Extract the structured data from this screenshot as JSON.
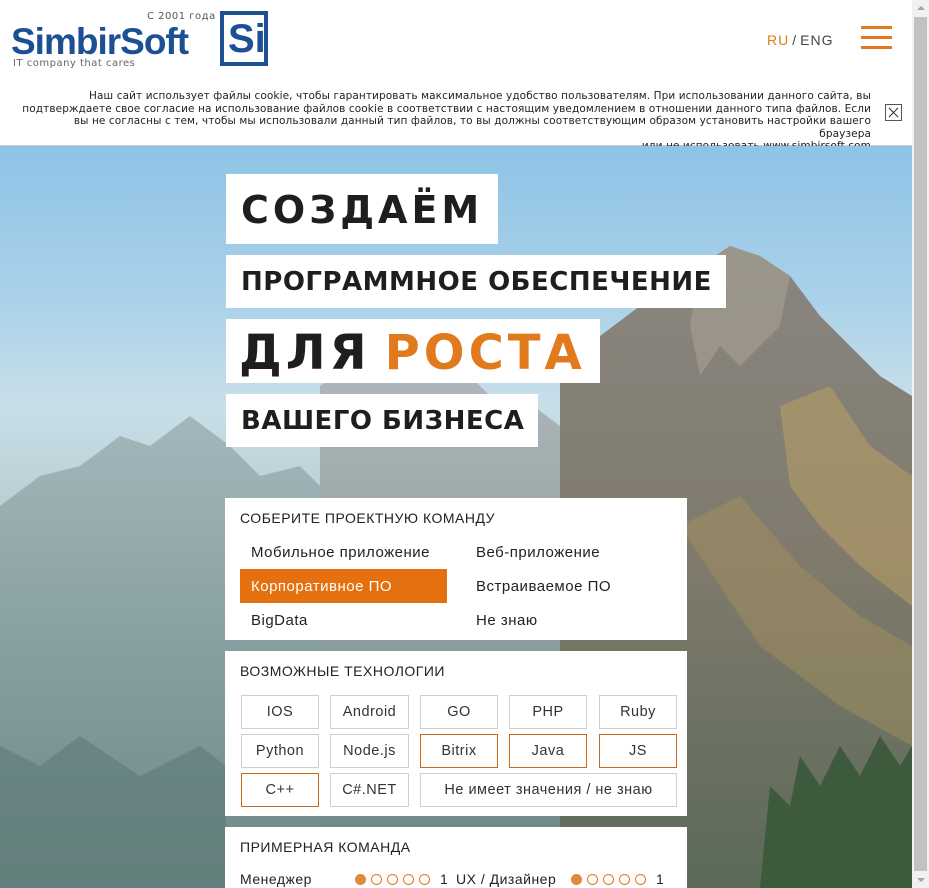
{
  "header": {
    "logo_since": "С 2001 года",
    "logo_word": "SimbirSoft",
    "logo_mark": "Si",
    "logo_tagline": "IT company that cares",
    "lang_ru": "RU",
    "lang_sep": "/",
    "lang_eng": "ENG",
    "menu_icon": "hamburger-icon"
  },
  "cookie_notice": {
    "line1": "Наш сайт использует файлы cookie, чтобы гарантировать максимальное удобство пользователям. При использовании данного сайта, вы",
    "line2": "подтверждаете свое согласие на использование файлов cookie в соответствии с настоящим уведомлением в отношении данного типа файлов. Если",
    "line3": "вы не согласны с тем, чтобы мы использовали данный тип файлов, то вы должны соответствующим образом установить настройки вашего браузера",
    "line4": "или не использовать www.simbirsoft.com",
    "close_icon": "close-icon"
  },
  "hero": {
    "line1": "СОЗДАЁМ",
    "line2": "ПРОГРАММНОЕ ОБЕСПЕЧЕНИЕ",
    "line3_a": "ДЛЯ",
    "line3_b": "РОСТА",
    "line4": "ВАШЕГО БИЗНЕСА"
  },
  "project_panel": {
    "title": "СОБЕРИТЕ ПРОЕКТНУЮ КОМАНДУ",
    "options": [
      "Мобильное приложение",
      "Веб-приложение",
      "Корпоративное ПО",
      "Встраиваемое ПО",
      "BigData",
      "Не знаю"
    ],
    "selected": "Корпоративное ПО"
  },
  "tech_panel": {
    "title": "ВОЗМОЖНЫЕ ТЕХНОЛОГИИ",
    "items": [
      "IOS",
      "Android",
      "GO",
      "PHP",
      "Ruby",
      "Python",
      "Node.js",
      "Bitrix",
      "Java",
      "JS",
      "C++",
      "C#.NET",
      "Не имеет значения / не знаю"
    ],
    "selected": [
      "Bitrix",
      "Java",
      "JS",
      "C++"
    ]
  },
  "team_panel": {
    "title": "ПРИМЕРНАЯ КОМАНДА",
    "roles": [
      {
        "label": "Менеджер",
        "count": "1",
        "level": 1,
        "max": 5
      },
      {
        "label": "UX / Дизайнер",
        "count": "1",
        "level": 1,
        "max": 5
      }
    ]
  },
  "colors": {
    "accent": "#e5700f",
    "brand_blue": "#1c4f94"
  }
}
